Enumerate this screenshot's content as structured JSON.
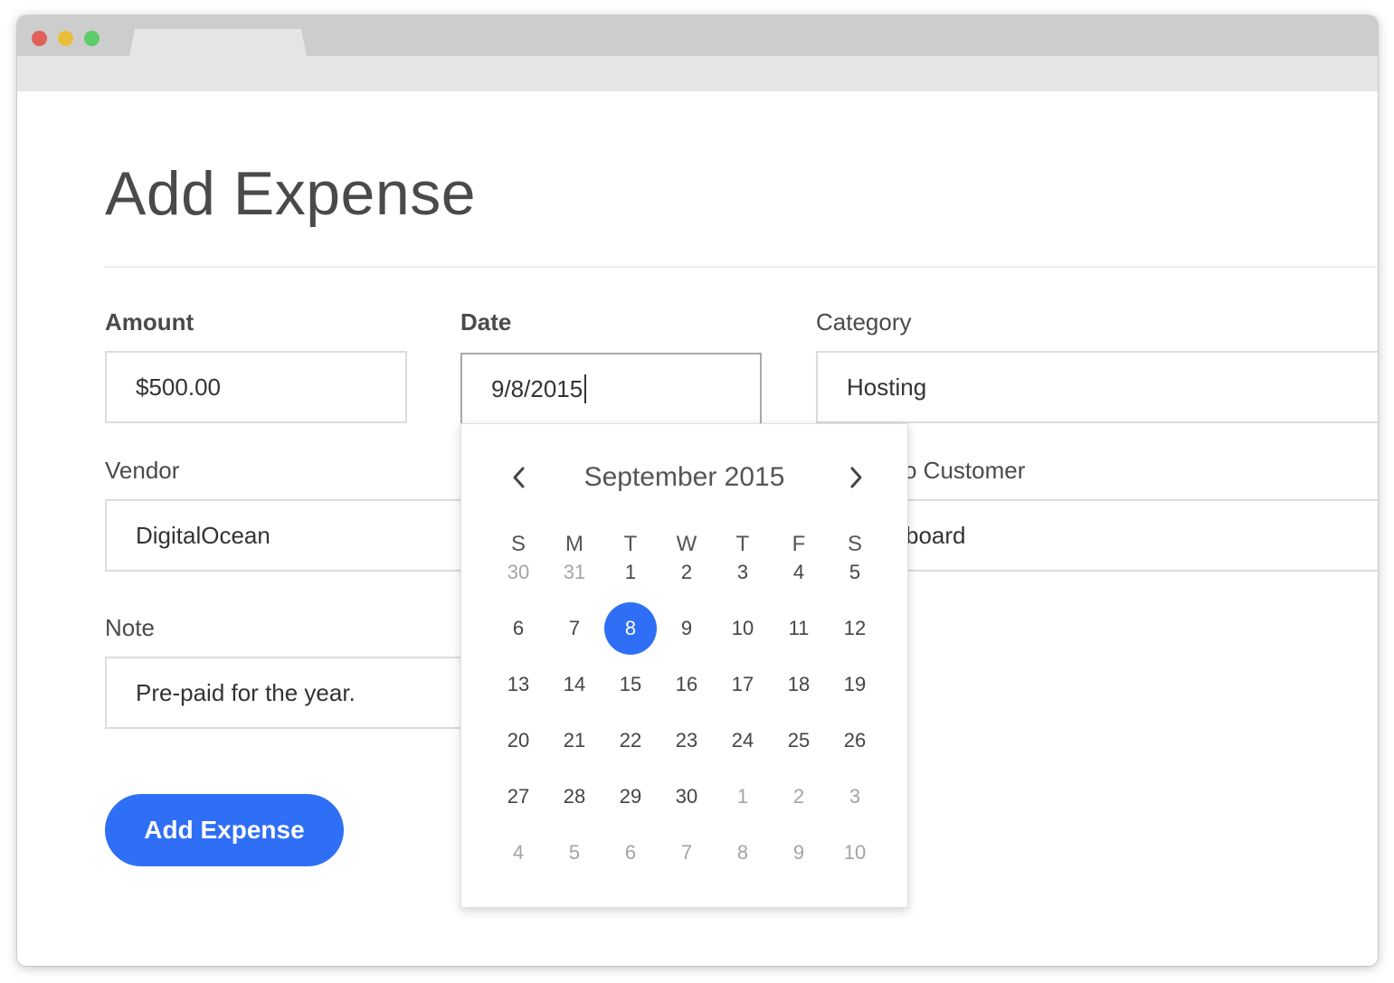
{
  "window": {
    "controls": [
      "close",
      "minimize",
      "zoom"
    ],
    "colors": {
      "close": "#e0605a",
      "minimize": "#e9be3a",
      "zoom": "#5ccb6a"
    }
  },
  "page": {
    "title": "Add Expense"
  },
  "form": {
    "amount": {
      "label": "Amount",
      "value": "$500.00"
    },
    "date": {
      "label": "Date",
      "value": "9/8/2015"
    },
    "category": {
      "label": "Category",
      "value": "Hosting"
    },
    "vendor": {
      "label": "Vendor",
      "value": "DigitalOcean"
    },
    "customer": {
      "label_visible_fragment": "o Customer",
      "value_visible_fragment": "board"
    },
    "note": {
      "label": "Note",
      "value": "Pre-paid for the year."
    },
    "submit_label": "Add Expense"
  },
  "datepicker": {
    "month_label": "September 2015",
    "prev_icon": "chevron-left-icon",
    "next_icon": "chevron-right-icon",
    "weekdays": [
      "S",
      "M",
      "T",
      "W",
      "T",
      "F",
      "S"
    ],
    "weeks": [
      [
        {
          "d": "30",
          "m": true
        },
        {
          "d": "31",
          "m": true
        },
        {
          "d": "1"
        },
        {
          "d": "2"
        },
        {
          "d": "3"
        },
        {
          "d": "4"
        },
        {
          "d": "5"
        }
      ],
      [
        {
          "d": "6"
        },
        {
          "d": "7"
        },
        {
          "d": "8",
          "sel": true
        },
        {
          "d": "9"
        },
        {
          "d": "10"
        },
        {
          "d": "11"
        },
        {
          "d": "12"
        }
      ],
      [
        {
          "d": "13"
        },
        {
          "d": "14"
        },
        {
          "d": "15"
        },
        {
          "d": "16"
        },
        {
          "d": "17"
        },
        {
          "d": "18"
        },
        {
          "d": "19"
        }
      ],
      [
        {
          "d": "20"
        },
        {
          "d": "21"
        },
        {
          "d": "22"
        },
        {
          "d": "23"
        },
        {
          "d": "24"
        },
        {
          "d": "25"
        },
        {
          "d": "26"
        }
      ],
      [
        {
          "d": "27"
        },
        {
          "d": "28"
        },
        {
          "d": "29"
        },
        {
          "d": "30"
        },
        {
          "d": "1",
          "m": true
        },
        {
          "d": "2",
          "m": true
        },
        {
          "d": "3",
          "m": true
        }
      ],
      [
        {
          "d": "4",
          "m": true
        },
        {
          "d": "5",
          "m": true
        },
        {
          "d": "6",
          "m": true
        },
        {
          "d": "7",
          "m": true
        },
        {
          "d": "8",
          "m": true
        },
        {
          "d": "9",
          "m": true
        },
        {
          "d": "10",
          "m": true
        }
      ]
    ]
  },
  "theme": {
    "accent": "#2f6ff5",
    "text": "#4a4a4a",
    "muted": "#a4a4a4"
  }
}
